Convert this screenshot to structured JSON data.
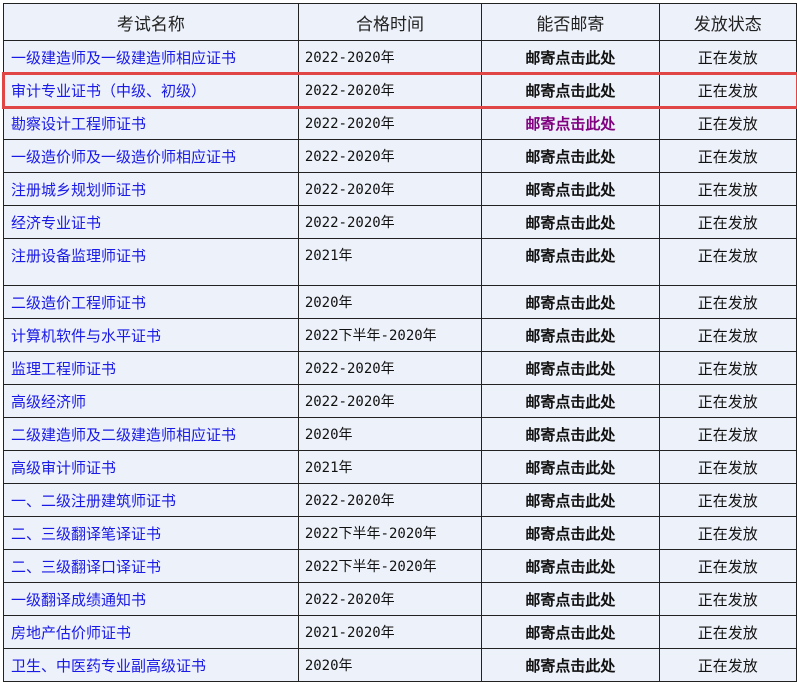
{
  "headers": [
    "考试名称",
    "合格时间",
    "能否邮寄",
    "发放状态"
  ],
  "rows": [
    {
      "name": "一级建造师及一级建造师相应证书",
      "time": "2022-2020年",
      "mail": "邮寄点击此处",
      "status": "正在发放"
    },
    {
      "name": "审计专业证书（中级、初级）",
      "time": "2022-2020年",
      "mail": "邮寄点击此处",
      "status": "正在发放"
    },
    {
      "name": "勘察设计工程师证书",
      "time": "2022-2020年",
      "mail": "邮寄点击此处",
      "status": "正在发放"
    },
    {
      "name": "一级造价师及一级造价师相应证书",
      "time": "2022-2020年",
      "mail": "邮寄点击此处",
      "status": "正在发放"
    },
    {
      "name": "注册城乡规划师证书",
      "time": "2022-2020年",
      "mail": "邮寄点击此处",
      "status": "正在发放"
    },
    {
      "name": "经济专业证书",
      "time": "2022-2020年",
      "mail": "邮寄点击此处",
      "status": "正在发放"
    },
    {
      "name": "注册设备监理师证书",
      "time": "2021年",
      "mail": "邮寄点击此处",
      "status": "正在发放"
    },
    {
      "name": "二级造价工程师证书",
      "time": "2020年",
      "mail": "邮寄点击此处",
      "status": "正在发放"
    },
    {
      "name": "计算机软件与水平证书",
      "time": "2022下半年-2020年",
      "mail": "邮寄点击此处",
      "status": "正在发放"
    },
    {
      "name": "监理工程师证书",
      "time": "2022-2020年",
      "mail": "邮寄点击此处",
      "status": "正在发放"
    },
    {
      "name": "高级经济师",
      "time": "2022-2020年",
      "mail": "邮寄点击此处",
      "status": "正在发放"
    },
    {
      "name": "二级建造师及二级建造师相应证书",
      "time": "2020年",
      "mail": "邮寄点击此处",
      "status": "正在发放"
    },
    {
      "name": "高级审计师证书",
      "time": "2021年",
      "mail": "邮寄点击此处",
      "status": "正在发放"
    },
    {
      "name": "一、二级注册建筑师证书",
      "time": "2022-2020年",
      "mail": "邮寄点击此处",
      "status": "正在发放"
    },
    {
      "name": "二、三级翻译笔译证书",
      "time": "2022下半年-2020年",
      "mail": "邮寄点击此处",
      "status": "正在发放"
    },
    {
      "name": "二、三级翻译口译证书",
      "time": "2022下半年-2020年",
      "mail": "邮寄点击此处",
      "status": "正在发放"
    },
    {
      "name": "一级翻译成绩通知书",
      "time": "2022-2020年",
      "mail": "邮寄点击此处",
      "status": "正在发放"
    },
    {
      "name": "房地产估价师证书",
      "time": "2021-2020年",
      "mail": "邮寄点击此处",
      "status": "正在发放"
    },
    {
      "name": "卫生、中医药专业副高级证书",
      "time": "2020年",
      "mail": "邮寄点击此处",
      "status": "正在发放"
    }
  ],
  "colors": {
    "link": "#1a1ae6",
    "visited": "#800080",
    "highlight": "#e04646"
  }
}
